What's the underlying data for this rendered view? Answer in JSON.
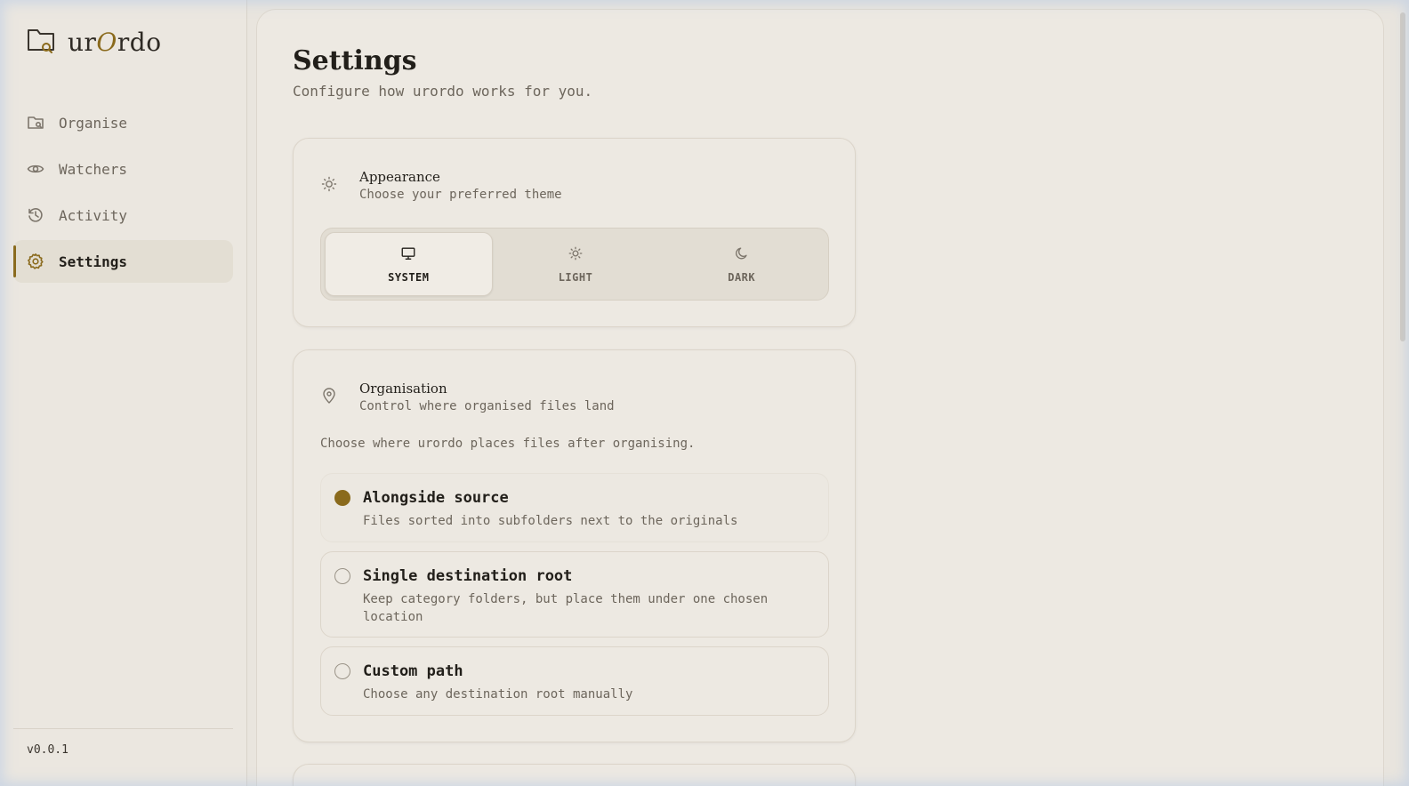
{
  "app": {
    "logo_prefix": "ur",
    "logo_accent": "O",
    "logo_suffix": "rdo",
    "version": "v0.0.1"
  },
  "sidebar": {
    "items": [
      {
        "label": "Organise",
        "icon": "folder-search-icon",
        "active": false
      },
      {
        "label": "Watchers",
        "icon": "eye-icon",
        "active": false
      },
      {
        "label": "Activity",
        "icon": "history-icon",
        "active": false
      },
      {
        "label": "Settings",
        "icon": "gear-icon",
        "active": true
      }
    ]
  },
  "page": {
    "title": "Settings",
    "subtitle": "Configure how urordo works for you."
  },
  "appearance": {
    "title": "Appearance",
    "description": "Choose your preferred theme",
    "icon": "sun-icon",
    "options": [
      {
        "label": "SYSTEM",
        "icon": "monitor-icon",
        "selected": true
      },
      {
        "label": "LIGHT",
        "icon": "sun-icon",
        "selected": false
      },
      {
        "label": "DARK",
        "icon": "moon-icon",
        "selected": false
      }
    ]
  },
  "organisation": {
    "title": "Organisation",
    "description": "Control where organised files land",
    "icon": "map-pin-icon",
    "intro": "Choose where urordo places files after organising.",
    "options": [
      {
        "title": "Alongside source",
        "description": "Files sorted into subfolders next to the originals",
        "selected": true
      },
      {
        "title": "Single destination root",
        "description": "Keep category folders, but place them under one chosen location",
        "selected": false
      },
      {
        "title": "Custom path",
        "description": "Choose any destination root manually",
        "selected": false
      }
    ]
  },
  "colors": {
    "accent": "#8a6a1c",
    "background": "#e9e5de",
    "text": "#221f1a"
  }
}
